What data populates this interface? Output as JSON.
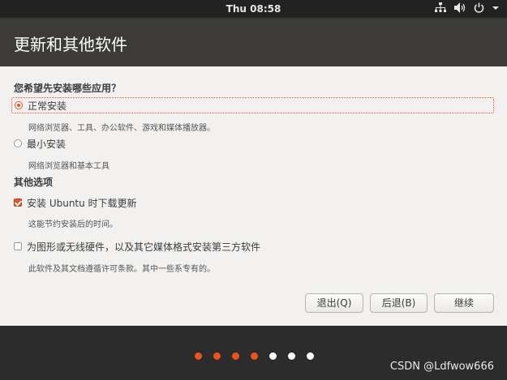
{
  "topbar": {
    "clock": "Thu 08:58",
    "icons": [
      "network-icon",
      "volume-icon",
      "power-icon",
      "menu-arrow-icon"
    ]
  },
  "window": {
    "title": "更新和其他软件"
  },
  "install_question": "您希望先安装哪些应用？",
  "install_options": [
    {
      "label": "正常安装",
      "description": "网络浏览器、工具、办公软件、游戏和媒体播放器。",
      "selected": true
    },
    {
      "label": "最小安装",
      "description": "网络浏览器和基本工具",
      "selected": false
    }
  ],
  "other_options_title": "其他选项",
  "other_options": [
    {
      "label": "安装 Ubuntu 时下载更新",
      "description": "这能节约安装后的时间。",
      "checked": true
    },
    {
      "label": "为图形或无线硬件，以及其它媒体格式安装第三方软件",
      "description": "此软件及其文档遵循许可条款。其中一些系专有的。",
      "checked": false
    }
  ],
  "buttons": {
    "quit": "退出(Q)",
    "back": "后退(B)",
    "continue": "继续"
  },
  "progress": {
    "total_steps": 7,
    "completed_steps": 4,
    "active_color": "#e95420",
    "inactive_color": "#ffffff"
  },
  "watermark": "CSDN @Ldfwow666",
  "colors": {
    "accent": "#e95420",
    "titlebar": "#3c3b37",
    "background": "#f2f1f0",
    "desktop": "#2c2c2c"
  }
}
